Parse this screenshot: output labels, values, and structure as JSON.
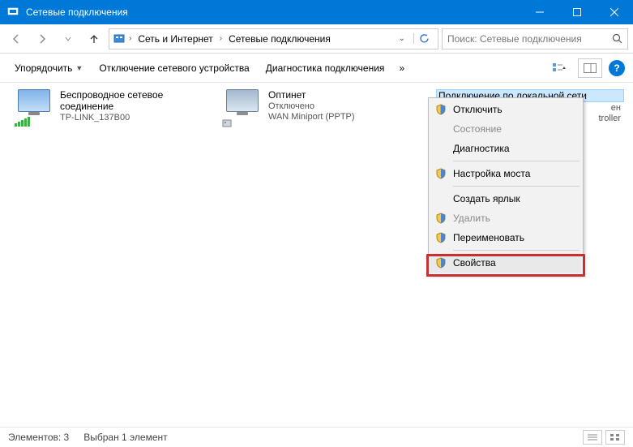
{
  "window": {
    "title": "Сетевые подключения"
  },
  "breadcrumb": {
    "root": "Сеть и Интернет",
    "leaf": "Сетевые подключения"
  },
  "search": {
    "placeholder": "Поиск: Сетевые подключения"
  },
  "toolbar": {
    "organize": "Упорядочить",
    "disable": "Отключение сетевого устройства",
    "diagnose": "Диагностика подключения"
  },
  "connections": [
    {
      "name": "Беспроводное сетевое соединение",
      "status": "TP-LINK_137B00",
      "device": ""
    },
    {
      "name": "Оптинет",
      "status": "Отключено",
      "device": "WAN Miniport (PPTP)"
    },
    {
      "name": "Подключение по локальной сети",
      "status": "ен",
      "device": "troller"
    }
  ],
  "context_menu": {
    "items": [
      {
        "label": "Отключить",
        "shield": true,
        "enabled": true
      },
      {
        "label": "Состояние",
        "shield": false,
        "enabled": false
      },
      {
        "label": "Диагностика",
        "shield": false,
        "enabled": true
      }
    ],
    "items2": [
      {
        "label": "Настройка моста",
        "shield": true,
        "enabled": true
      }
    ],
    "items3": [
      {
        "label": "Создать ярлык",
        "shield": false,
        "enabled": true
      },
      {
        "label": "Удалить",
        "shield": true,
        "enabled": false
      },
      {
        "label": "Переименовать",
        "shield": true,
        "enabled": true
      }
    ],
    "items4": [
      {
        "label": "Свойства",
        "shield": true,
        "enabled": true,
        "highlighted": true
      }
    ]
  },
  "statusbar": {
    "count": "Элементов: 3",
    "selected": "Выбран 1 элемент"
  }
}
